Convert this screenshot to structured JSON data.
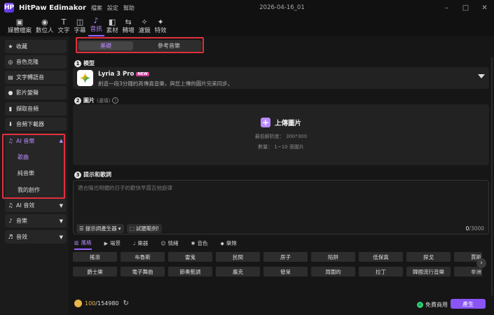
{
  "app": {
    "name": "HitPaw Edimakor",
    "menu": [
      "檔案",
      "設定",
      "幫助"
    ],
    "project": "2026-04-16_01"
  },
  "toolbar": [
    {
      "label": "媒體檔案",
      "icon": "media-icon"
    },
    {
      "label": "數位人",
      "icon": "avatar-icon"
    },
    {
      "label": "文字",
      "icon": "text-icon"
    },
    {
      "label": "字幕",
      "icon": "subtitle-icon"
    },
    {
      "label": "音訊",
      "icon": "audio-icon"
    },
    {
      "label": "素材",
      "icon": "sticker-icon"
    },
    {
      "label": "轉場",
      "icon": "transition-icon"
    },
    {
      "label": "濾鏡",
      "icon": "filter-icon"
    },
    {
      "label": "特效",
      "icon": "effect-icon"
    }
  ],
  "sidebar": {
    "items": [
      "收藏",
      "音色克隆",
      "文字轉語音",
      "影片變聲",
      "擷取音頻",
      "音頻下載器"
    ],
    "ai_music": {
      "label": "AI 音樂",
      "subs": [
        "歌曲",
        "純音樂",
        "我的創作"
      ]
    },
    "bottom": [
      "AI 音效",
      "音樂",
      "音效"
    ]
  },
  "main": {
    "tabs": [
      "基礎",
      "參考音樂"
    ],
    "model": {
      "heading": "模型",
      "name": "Lyria 3 Pro",
      "badge": "NEW",
      "desc": "創造一段3分鐘的高傳真音樂，與您上傳的圖片完美同步。"
    },
    "image": {
      "heading": "圖片",
      "optional": "(選填)",
      "upload_label": "上傳圖片",
      "min_res": "最低解析度： 300*300",
      "count": "數量： 1~10 張圖片"
    },
    "prompt": {
      "heading": "提示和歌詞",
      "placeholder": "適合陽光明媚的日子的歡快早晨吉他旋律",
      "generator": "提示詞產生器",
      "example": "試聽範例!",
      "counter_current": "0",
      "counter_max": "/3000"
    },
    "categories": [
      "風格",
      "場景",
      "樂器",
      "情緒",
      "音色",
      "樂隊"
    ],
    "chips_row1": [
      "搖滾",
      "布魯斯",
      "雷鬼",
      "民間",
      "房子",
      "陷阱",
      "低保真",
      "探戈",
      "賈斯"
    ],
    "chips_row2": [
      "爵士樂",
      "電子舞曲",
      "節奏藍調",
      "龐克",
      "發呆",
      "周圍的",
      "拉丁",
      "韓國流行音樂",
      "非洲"
    ],
    "footer": {
      "credits_used": "100",
      "credits_total": "/154980",
      "free": "免費商用",
      "generate": "產生"
    }
  }
}
